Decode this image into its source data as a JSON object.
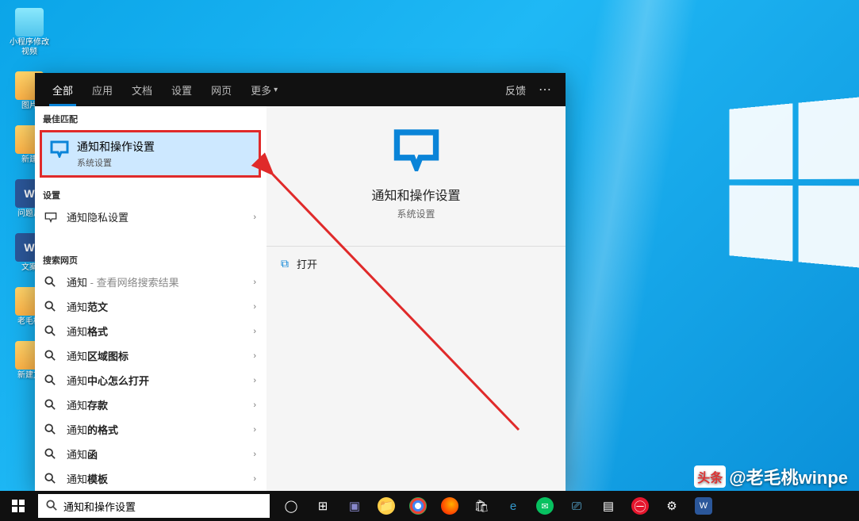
{
  "desktop": {
    "icons": [
      {
        "label": "小程序修改视频",
        "type": "generic"
      },
      {
        "label": "图片",
        "type": "folder"
      },
      {
        "label": "新建",
        "type": "folder"
      },
      {
        "label": "问题反",
        "type": "word"
      },
      {
        "label": "文案",
        "type": "word"
      },
      {
        "label": "老毛桃",
        "type": "folder"
      },
      {
        "label": "新建文",
        "type": "folder"
      }
    ]
  },
  "tabs": {
    "items": [
      "全部",
      "应用",
      "文档",
      "设置",
      "网页",
      "更多"
    ],
    "feedback": "反馈"
  },
  "groups": {
    "best_match": "最佳匹配",
    "settings": "设置",
    "web": "搜索网页"
  },
  "best_match": {
    "title": "通知和操作设置",
    "subtitle": "系统设置"
  },
  "settings_rows": [
    {
      "label": "通知隐私设置"
    }
  ],
  "web_rows": [
    {
      "prefix": "通知",
      "hint": " - 查看网络搜索结果"
    },
    {
      "prefix": "通知",
      "hint": "范文"
    },
    {
      "prefix": "通知",
      "hint": "格式"
    },
    {
      "prefix": "通知",
      "hint": "区域图标"
    },
    {
      "prefix": "通知",
      "hint": "中心怎么打开"
    },
    {
      "prefix": "通知",
      "hint": "存款"
    },
    {
      "prefix": "通知",
      "hint": "的格式"
    },
    {
      "prefix": "通知",
      "hint": "函"
    },
    {
      "prefix": "通知",
      "hint": "模板"
    }
  ],
  "preview": {
    "title": "通知和操作设置",
    "subtitle": "系统设置",
    "open": "打开"
  },
  "search_input": {
    "value": "通知和操作设置"
  },
  "watermark": {
    "badge": "头条",
    "text": "@老毛桃winpe"
  }
}
